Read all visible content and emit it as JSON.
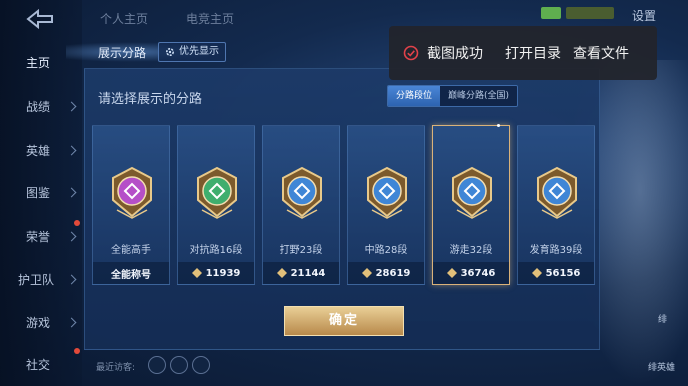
{
  "top": {
    "tabs": [
      "个人主页",
      "电竞主页"
    ],
    "settings_label": "设置"
  },
  "nav": {
    "back_icon": "back-arrow-icon",
    "items": [
      {
        "label": "主页",
        "active": true
      },
      {
        "label": "战绩",
        "active": false
      },
      {
        "label": "英雄",
        "active": false
      },
      {
        "label": "图鉴",
        "active": false
      },
      {
        "label": "荣誉",
        "active": false
      },
      {
        "label": "护卫队",
        "active": false
      },
      {
        "label": "游戏",
        "active": false
      },
      {
        "label": "社交",
        "active": false
      }
    ]
  },
  "panel": {
    "title": "展示分路",
    "priority_label": "优先显示",
    "prompt": "请选择展示的分路",
    "segments": [
      {
        "label": "分路段位",
        "active": true
      },
      {
        "label": "巅峰分路(全国)",
        "active": false
      }
    ],
    "cards": [
      {
        "name": "全能高手",
        "value": "全能称号",
        "has_diamond": false,
        "selected": false,
        "color": "#b54fc8"
      },
      {
        "name": "对抗路16段",
        "value": "11939",
        "has_diamond": true,
        "selected": false,
        "color": "#3fae6e"
      },
      {
        "name": "打野23段",
        "value": "21144",
        "has_diamond": true,
        "selected": false,
        "color": "#3f86d6"
      },
      {
        "name": "中路28段",
        "value": "28619",
        "has_diamond": true,
        "selected": false,
        "color": "#3f86d6"
      },
      {
        "name": "游走32段",
        "value": "36746",
        "has_diamond": true,
        "selected": true,
        "color": "#3f86d6"
      },
      {
        "name": "发育路39段",
        "value": "56156",
        "has_diamond": true,
        "selected": false,
        "color": "#3f86d6"
      }
    ],
    "confirm_label": "确定"
  },
  "toast": {
    "message": "截图成功",
    "open_dir": "打开目录",
    "view_file": "查看文件"
  },
  "bottom": {
    "recent_visitors": "最近访客:"
  },
  "right_labels": [
    "绯",
    "绯英雄"
  ]
}
